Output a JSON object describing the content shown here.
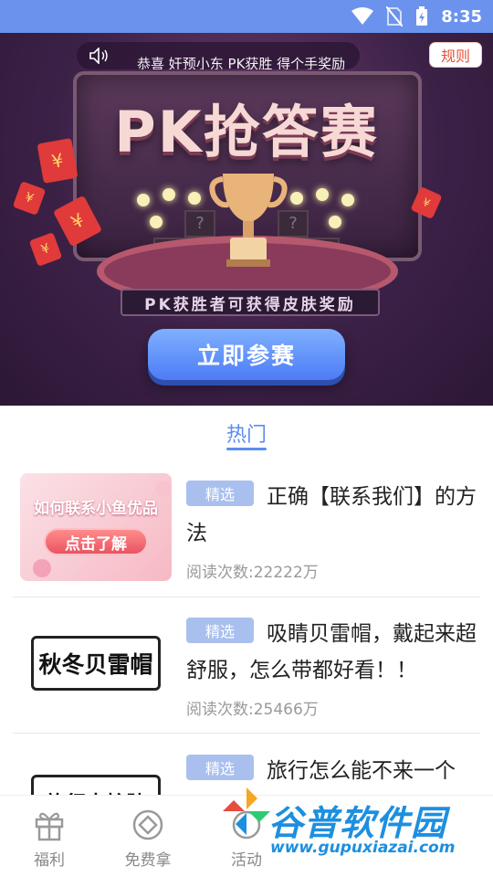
{
  "status_bar": {
    "time": "8:35"
  },
  "banner": {
    "ticker_text": "恭喜 奸预小东 PK获胜 得个手奖励",
    "rules_label": "规则",
    "title": "PK抢答赛",
    "subtitle": "PK获胜者可获得皮肤奖励",
    "join_label": "立即参赛"
  },
  "tabs": {
    "hot_label": "热门"
  },
  "articles": [
    {
      "tag": "精选",
      "title": "正确【联系我们】的方法",
      "reads": "阅读次数:22222万",
      "thumb_title": "如何联系小鱼优品",
      "thumb_cta": "点击了解"
    },
    {
      "tag": "精选",
      "title": "吸睛贝雷帽，戴起来超舒服，怎么带都好看！！",
      "reads": "阅读次数:25466万",
      "thumb_sign": "秋冬贝雷帽"
    },
    {
      "tag": "精选",
      "title": "旅行怎么能不来一个",
      "thumb_sign": "旅行中护肤"
    }
  ],
  "bottom_nav": {
    "items": [
      {
        "label": "福利",
        "icon": "gift-icon"
      },
      {
        "label": "免费拿",
        "icon": "coin-icon"
      },
      {
        "label": "活动",
        "icon": "activity-icon"
      }
    ]
  },
  "watermark": {
    "text": "谷普软件园",
    "url": "www.gupuxiazai.com"
  },
  "colors": {
    "accent": "#5b8df0",
    "status_bar": "#6b93ee",
    "tag_bg": "#a9c0ef",
    "rules_text": "#e4533a"
  }
}
